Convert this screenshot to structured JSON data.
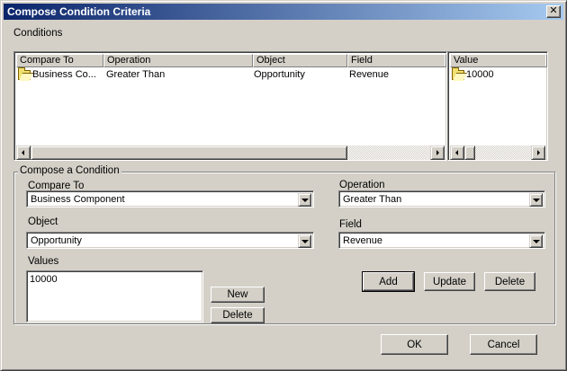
{
  "window": {
    "title": "Compose Condition Criteria",
    "close_glyph": "✕"
  },
  "conditions": {
    "section_label": "Conditions",
    "columns": [
      "Compare To",
      "Operation",
      "Object",
      "Field"
    ],
    "rows": [
      {
        "compare_to": "Business Co...",
        "operation": "Greater Than",
        "object": "Opportunity",
        "field": "Revenue"
      }
    ],
    "value_column": "Value",
    "value_rows": [
      "10000"
    ]
  },
  "compose": {
    "group_label": "Compose a Condition",
    "compare_to": {
      "label": "Compare To",
      "value": "Business Component"
    },
    "operation": {
      "label": "Operation",
      "value": "Greater Than"
    },
    "object": {
      "label": "Object",
      "value": "Opportunity"
    },
    "field": {
      "label": "Field",
      "value": "Revenue"
    },
    "values": {
      "label": "Values",
      "value": "10000"
    },
    "buttons": {
      "new": "New",
      "delete_value": "Delete",
      "add": "Add",
      "update": "Update",
      "delete": "Delete"
    }
  },
  "footer": {
    "ok": "OK",
    "cancel": "Cancel"
  },
  "icons": {
    "row_icon": "folder-icon"
  }
}
